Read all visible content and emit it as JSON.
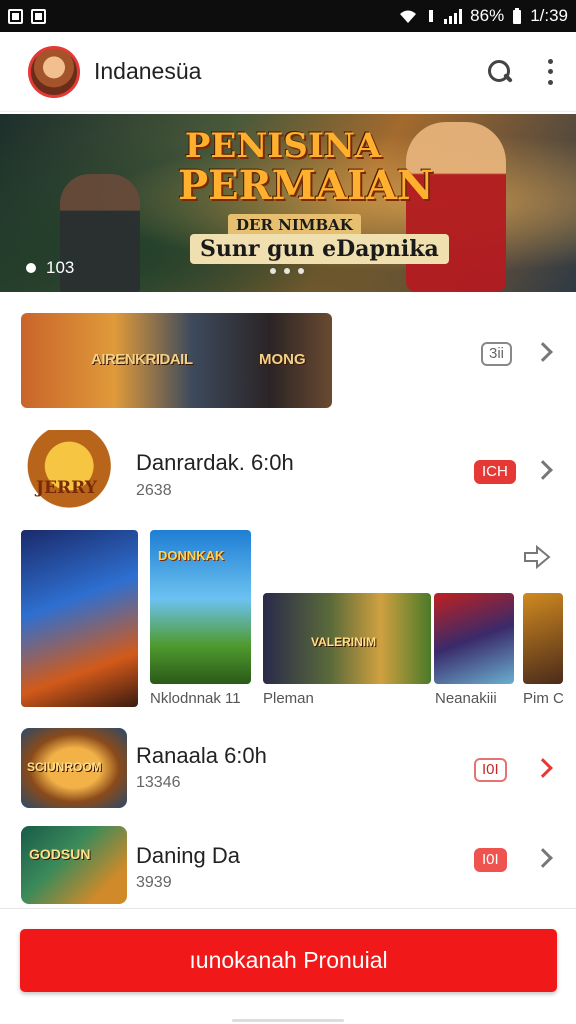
{
  "status_bar": {
    "battery": "86%",
    "time": "1/:39"
  },
  "app_bar": {
    "title": "Indanesüa"
  },
  "hero": {
    "title_line1": "PENISINA",
    "title_line2": "PERMAIAN",
    "subtitle1": "DER NIMBAK",
    "subtitle2": "Sunr gun eDapnika",
    "counter": "103"
  },
  "featured_banner": {
    "text_left": "AIRENKRIDAIL",
    "text_right": "MONG",
    "badge": "3ii"
  },
  "items": [
    {
      "logo_text": "JERRY",
      "title": "Danrardak. 6:0h",
      "subtitle": "2638",
      "badge": "ICH"
    },
    {
      "logo_text": "SCIUNROOM",
      "title": "Ranaala 6:0h",
      "subtitle": "13346",
      "badge": "I0I"
    },
    {
      "logo_text": "GODSUN",
      "title": "Daning Da",
      "subtitle": "3939",
      "badge": "I0I"
    }
  ],
  "carousel": {
    "card2_title": "DONNKAK",
    "card3_title": "VALERINIM",
    "captions": [
      "Nklodnnak 11",
      "Pleman",
      "Neanakiii",
      "Pim C"
    ]
  },
  "cta": {
    "label": "ıunokanah Pronuial"
  },
  "colors": {
    "accent": "#f01818",
    "badge_red": "#e53935"
  }
}
